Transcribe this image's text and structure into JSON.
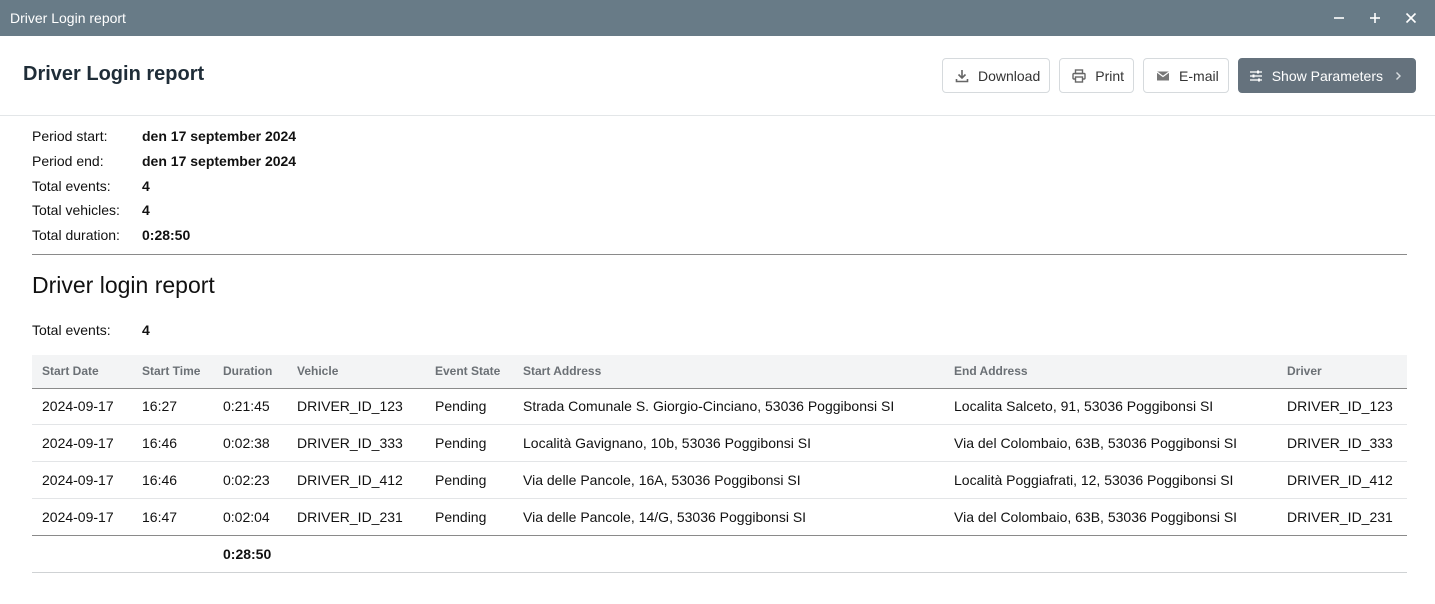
{
  "window": {
    "title": "Driver Login report",
    "controls": [
      "minimize-icon",
      "maximize-icon",
      "close-icon"
    ]
  },
  "header": {
    "title": "Driver Login report",
    "buttons": {
      "download": "Download",
      "print": "Print",
      "email": "E-mail",
      "show_parameters": "Show Parameters"
    }
  },
  "summary": {
    "period_start_label": "Period start:",
    "period_start": "den 17 september 2024",
    "period_end_label": "Period end:",
    "period_end": "den 17 september 2024",
    "total_events_label": "Total events:",
    "total_events": "4",
    "total_vehicles_label": "Total vehicles:",
    "total_vehicles": "4",
    "total_duration_label": "Total duration:",
    "total_duration": "0:28:50"
  },
  "section": {
    "title": "Driver login report",
    "total_events_label": "Total events:",
    "total_events": "4"
  },
  "table": {
    "columns": [
      "Start Date",
      "Start Time",
      "Duration",
      "Vehicle",
      "Event State",
      "Start Address",
      "End Address",
      "Driver"
    ],
    "rows": [
      [
        "2024-09-17",
        "16:27",
        "0:21:45",
        "DRIVER_ID_123",
        "Pending",
        "Strada Comunale S. Giorgio-Cinciano, 53036 Poggibonsi SI",
        "Localita Salceto, 91, 53036 Poggibonsi SI",
        "DRIVER_ID_123"
      ],
      [
        "2024-09-17",
        "16:46",
        "0:02:38",
        "DRIVER_ID_333",
        "Pending",
        "Località Gavignano, 10b, 53036 Poggibonsi SI",
        "Via del Colombaio, 63B, 53036 Poggibonsi SI",
        "DRIVER_ID_333"
      ],
      [
        "2024-09-17",
        "16:46",
        "0:02:23",
        "DRIVER_ID_412",
        "Pending",
        "Via delle Pancole, 16A, 53036 Poggibonsi SI",
        "Località Poggiafrati, 12, 53036 Poggibonsi SI",
        "DRIVER_ID_412"
      ],
      [
        "2024-09-17",
        "16:47",
        "0:02:04",
        "DRIVER_ID_231",
        "Pending",
        "Via delle Pancole, 14/G, 53036 Poggibonsi SI",
        "Via del Colombaio, 63B, 53036 Poggibonsi SI",
        "DRIVER_ID_231"
      ]
    ],
    "footer_duration": "0:28:50"
  },
  "colors": {
    "titlebar": "#687b87",
    "primary_button": "#65727d"
  }
}
